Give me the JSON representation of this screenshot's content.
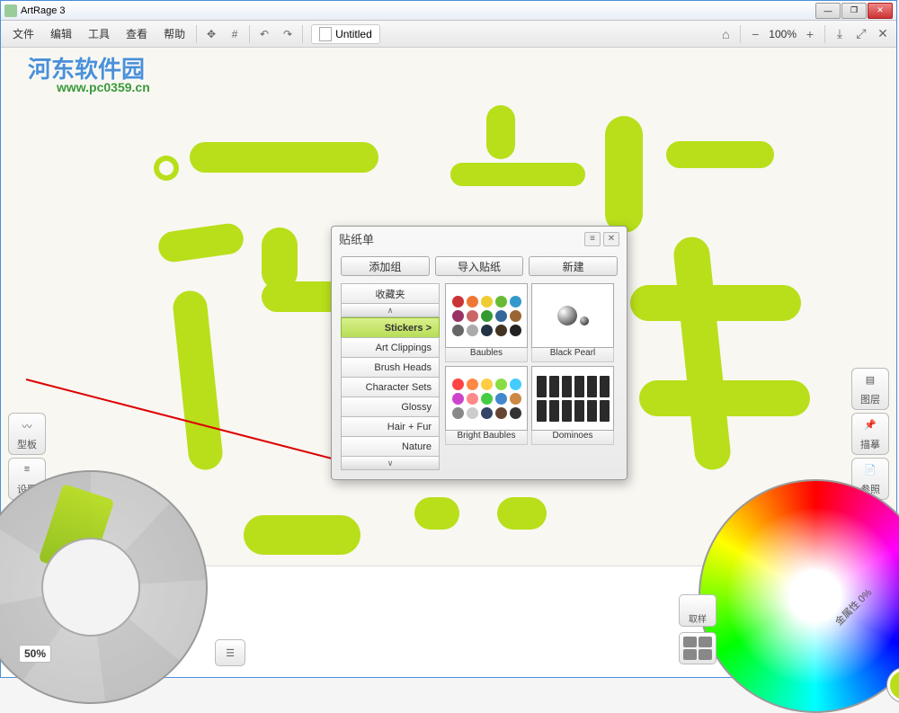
{
  "window": {
    "title": "ArtRage 3"
  },
  "menubar": {
    "items": [
      "文件",
      "编辑",
      "工具",
      "查看",
      "帮助"
    ]
  },
  "document": {
    "name": "Untitled"
  },
  "zoom": {
    "minus": "−",
    "pct": "100%",
    "plus": "+"
  },
  "watermark": {
    "big": "河东软件园",
    "url": "www.pc0359.cn"
  },
  "side": {
    "left": [
      "型板",
      "设置"
    ],
    "right": [
      "图层",
      "描摹",
      "参照"
    ]
  },
  "wheel": {
    "pct": "50%"
  },
  "color_panel": {
    "pick": "取样",
    "metal": "金属性 0%"
  },
  "dialog": {
    "title": "贴纸单",
    "buttons": [
      "添加组",
      "导入贴纸",
      "新建"
    ],
    "favorites": "收藏夹",
    "categories": [
      "Stickers  >",
      "Art Clippings",
      "Brush Heads",
      "Character Sets",
      "Glossy",
      "Hair + Fur",
      "Nature"
    ],
    "selected_index": 0,
    "previews": [
      "Baubles",
      "Black Pearl",
      "Bright Baubles",
      "Dominoes"
    ]
  }
}
